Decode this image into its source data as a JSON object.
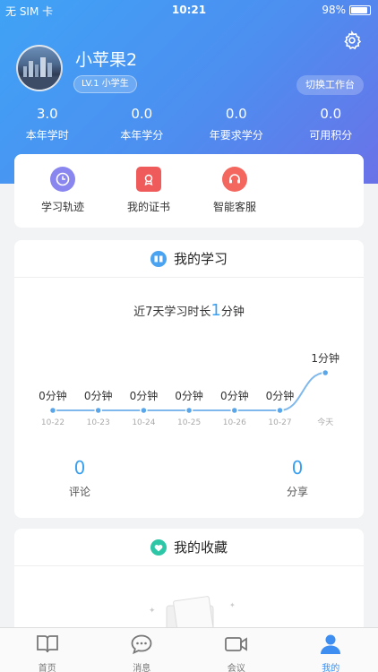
{
  "status_bar": {
    "carrier": "无 SIM 卡",
    "time": "10:21",
    "battery": "98%"
  },
  "profile": {
    "name": "小苹果2",
    "level": "LV.1 小学生",
    "switch_label": "切换工作台"
  },
  "stats": [
    {
      "value": "3.0",
      "label": "本年学时"
    },
    {
      "value": "0.0",
      "label": "本年学分"
    },
    {
      "value": "0.0",
      "label": "年要求学分"
    },
    {
      "value": "0.0",
      "label": "可用积分"
    }
  ],
  "quick_actions": [
    {
      "label": "学习轨迹",
      "icon": "clock-icon"
    },
    {
      "label": "我的证书",
      "icon": "certificate-icon"
    },
    {
      "label": "智能客服",
      "icon": "headset-icon"
    }
  ],
  "study": {
    "title": "我的学习",
    "summary_prefix": "近7天学习时长",
    "summary_value": "1",
    "summary_unit": "分钟",
    "comments": {
      "value": "0",
      "label": "评论"
    },
    "shares": {
      "value": "0",
      "label": "分享"
    }
  },
  "chart_data": {
    "type": "line",
    "x": [
      "10-22",
      "10-23",
      "10-24",
      "10-25",
      "10-26",
      "10-27",
      "今天"
    ],
    "values": [
      0,
      0,
      0,
      0,
      0,
      0,
      1
    ],
    "data_labels": [
      "0分钟",
      "0分钟",
      "0分钟",
      "0分钟",
      "0分钟",
      "0分钟",
      "1分钟"
    ],
    "ylim": [
      0,
      1
    ],
    "grid": false,
    "color": "#7fb8ec"
  },
  "favorites": {
    "title": "我的收藏"
  },
  "tabs": [
    {
      "label": "首页",
      "icon": "book-icon"
    },
    {
      "label": "消息",
      "icon": "message-icon"
    },
    {
      "label": "会议",
      "icon": "video-icon"
    },
    {
      "label": "我的",
      "icon": "user-icon",
      "active": true
    }
  ],
  "colors": {
    "accent": "#3d8ef0",
    "header_start": "#3fa3f5",
    "header_end": "#6a72e8"
  }
}
